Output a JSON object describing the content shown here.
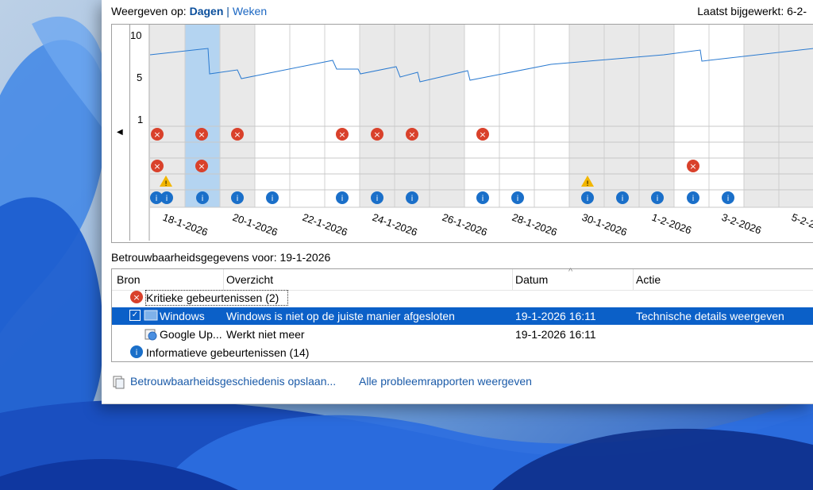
{
  "header": {
    "view_label": "Weergeven op:",
    "days": "Dagen",
    "separator": "|",
    "weeks": "Weken",
    "last_updated": "Laatst bijgewerkt: 6-2-"
  },
  "chart": {
    "y_ticks": [
      "10",
      "5",
      "1"
    ],
    "date_labels": [
      "18-1-2026",
      "20-1-2026",
      "22-1-2026",
      "24-1-2026",
      "26-1-2026",
      "28-1-2026",
      "30-1-2026",
      "1-2-2026",
      "3-2-2026",
      "5-2-2"
    ],
    "selected_day": "19-1-2026"
  },
  "details": {
    "title": "Betrouwbaarheidsgegevens voor: 19-1-2026",
    "columns": {
      "source": "Bron",
      "summary": "Overzicht",
      "date": "Datum",
      "action": "Actie"
    },
    "critical_group": "Kritieke gebeurtenissen (2)",
    "rows": [
      {
        "source": "Windows",
        "summary": "Windows is niet op de juiste manier afgesloten",
        "date": "19-1-2026 16:11",
        "action": "Technische details weergeven"
      },
      {
        "source": "Google Up...",
        "summary": "Werkt niet meer",
        "date": "19-1-2026 16:11",
        "action": ""
      }
    ],
    "info_group": "Informatieve gebeurtenissen (14)"
  },
  "footer": {
    "save_history": "Betrouwbaarheidsgeschiedenis opslaan...",
    "all_reports": "Alle probleemrapporten weergeven"
  },
  "colors": {
    "accent": "#0b60c8",
    "link": "#1a5aa8",
    "critical": "#d9412b",
    "info": "#1a6fc9",
    "warning": "#f2b600"
  }
}
